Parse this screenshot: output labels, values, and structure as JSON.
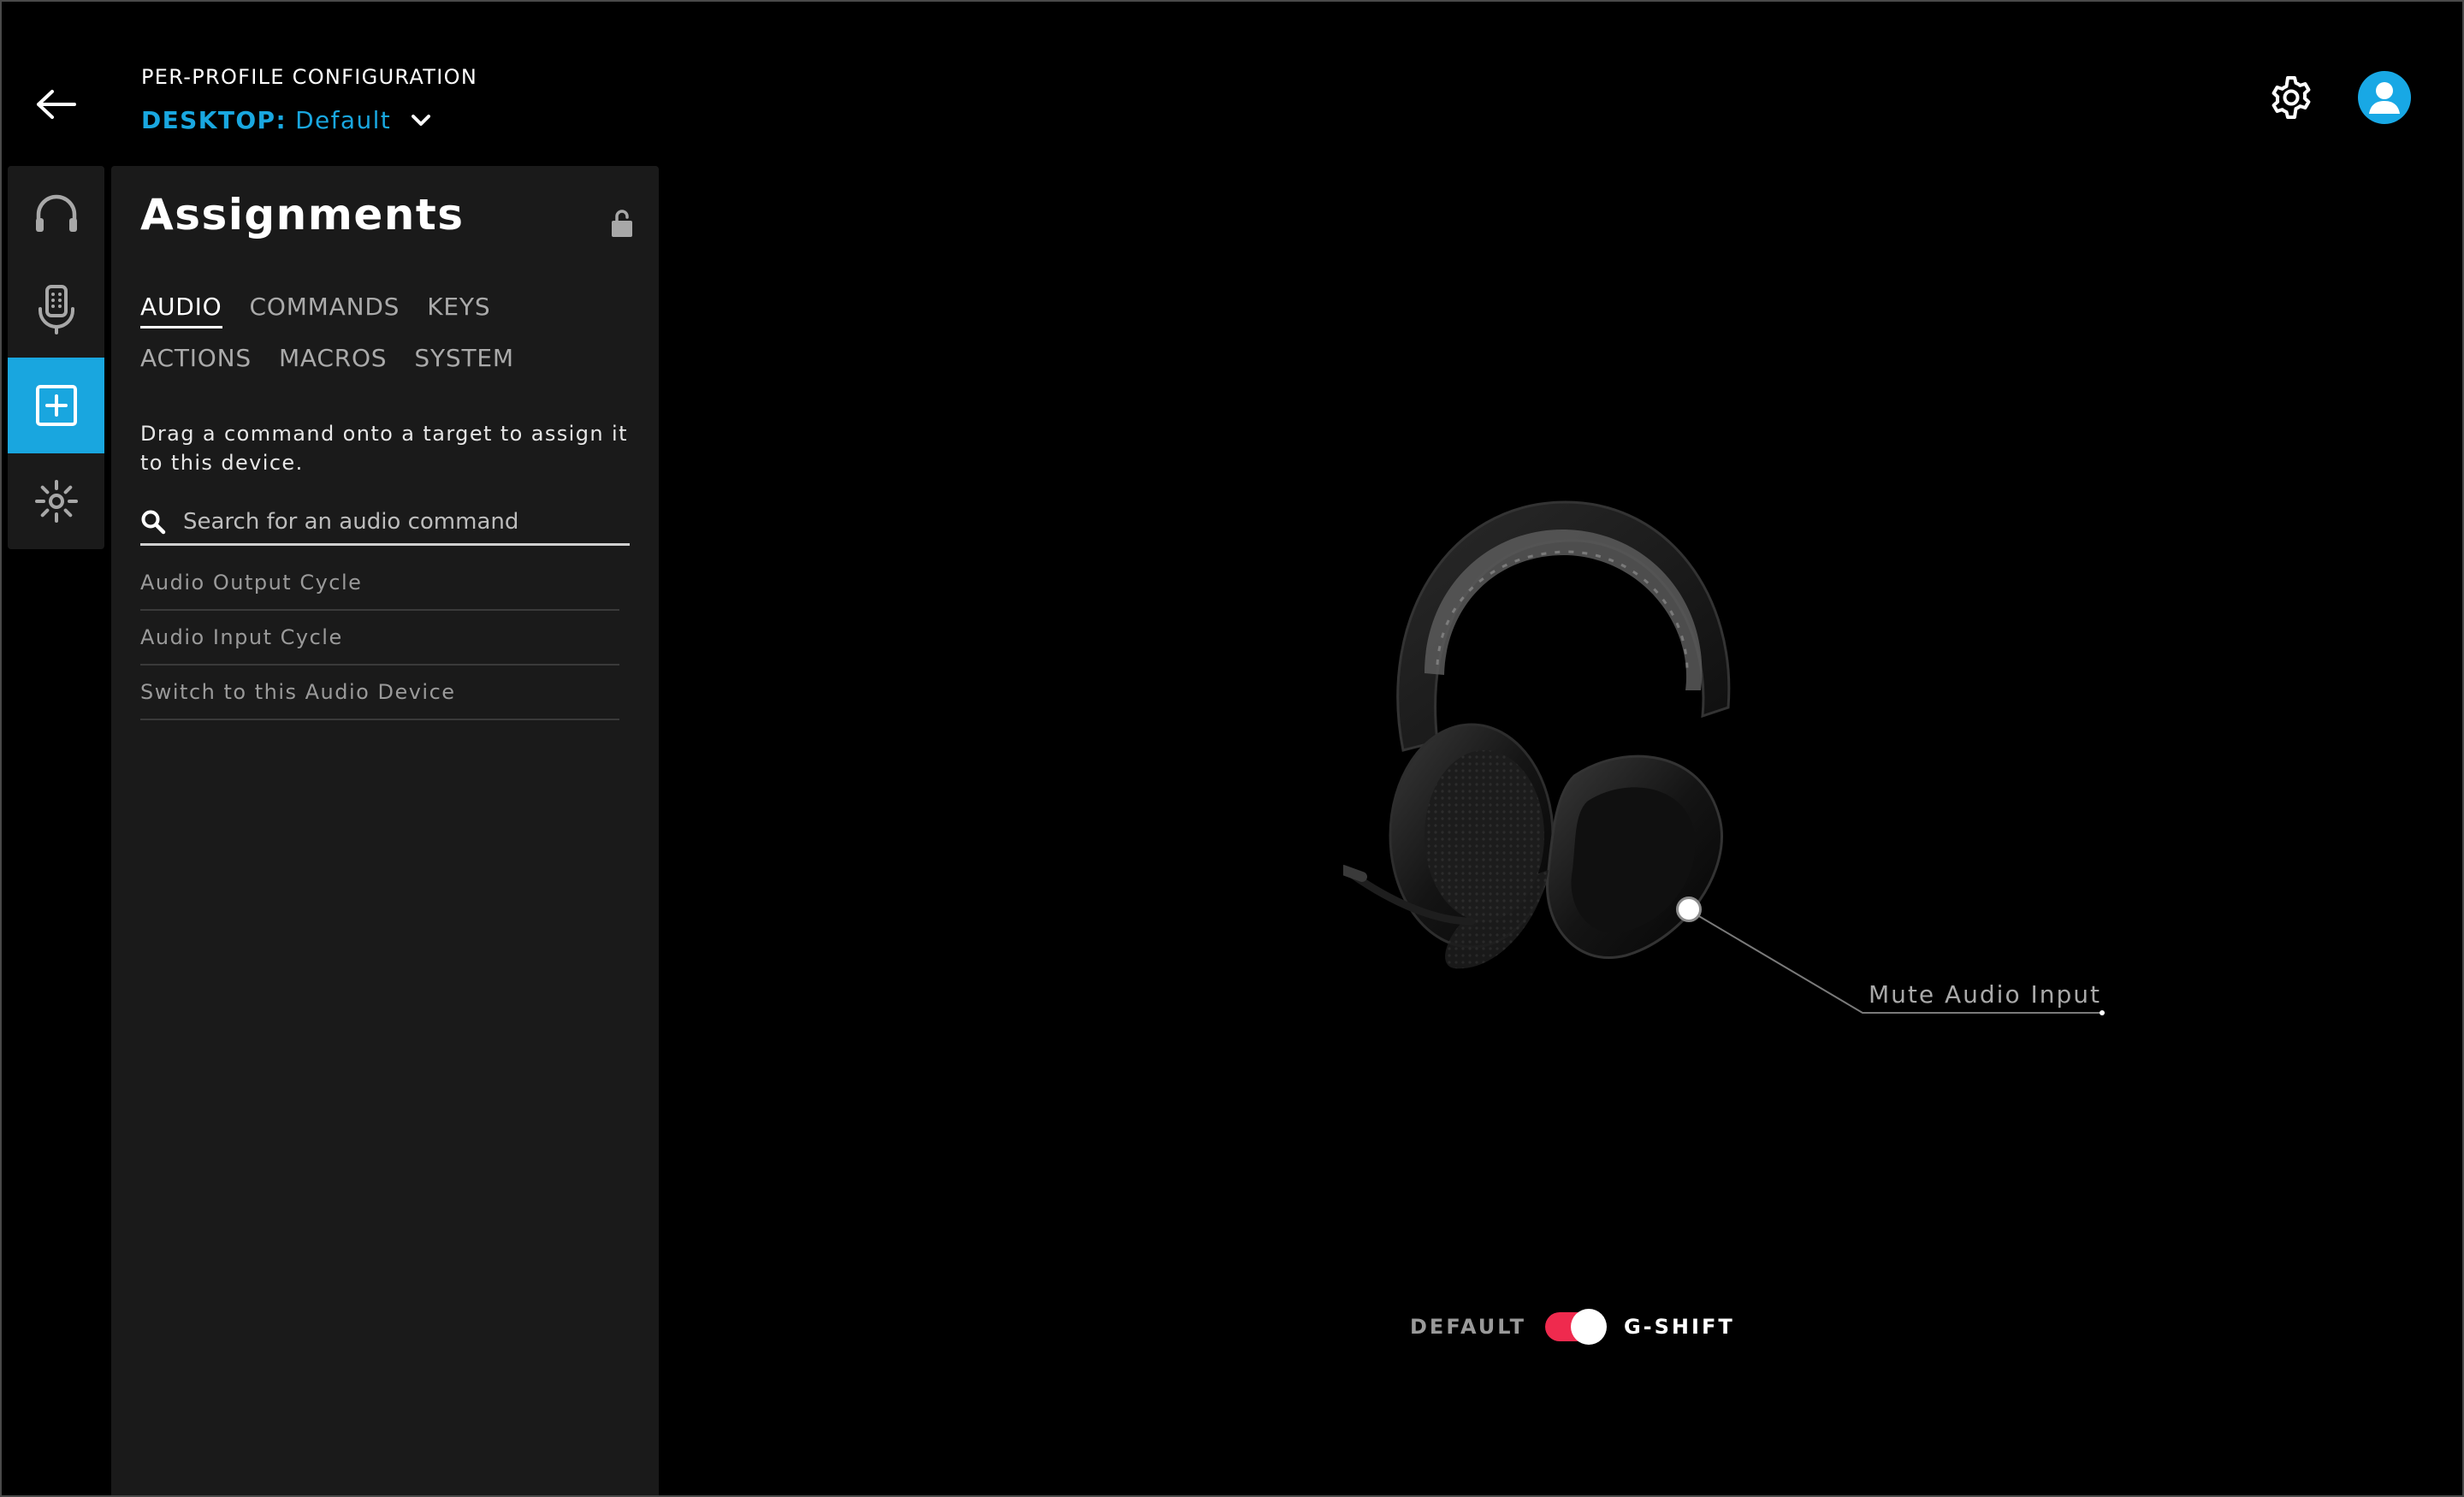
{
  "header": {
    "section_label": "PER-PROFILE CONFIGURATION",
    "profile_key": "DESKTOP:",
    "profile_value": "Default"
  },
  "icons": {
    "back": "arrow-left-icon",
    "settings": "gear-icon",
    "account": "user-icon",
    "rail": [
      "headphones-icon",
      "microphone-icon",
      "plus-square-icon",
      "lighting-icon"
    ],
    "lock": "unlock-icon",
    "search": "search-icon",
    "profile_dropdown": "chevron-down-icon"
  },
  "colors": {
    "accent": "#19a7e0",
    "toggle_on": "#ef2a4e"
  },
  "panel": {
    "title": "Assignments",
    "tabs_row1": [
      "AUDIO",
      "COMMANDS",
      "KEYS"
    ],
    "tabs_row2": [
      "ACTIONS",
      "MACROS",
      "SYSTEM"
    ],
    "active_tab": "AUDIO",
    "instructions": "Drag a command onto a target to assign it to this device.",
    "search_placeholder": "Search for an audio command",
    "commands": [
      "Audio Output Cycle",
      "Audio Input Cycle",
      "Switch to this Audio Device"
    ]
  },
  "device": {
    "callout_label": "Mute Audio Input",
    "toggle_left": "DEFAULT",
    "toggle_right": "G-SHIFT",
    "gshift_enabled": true
  }
}
